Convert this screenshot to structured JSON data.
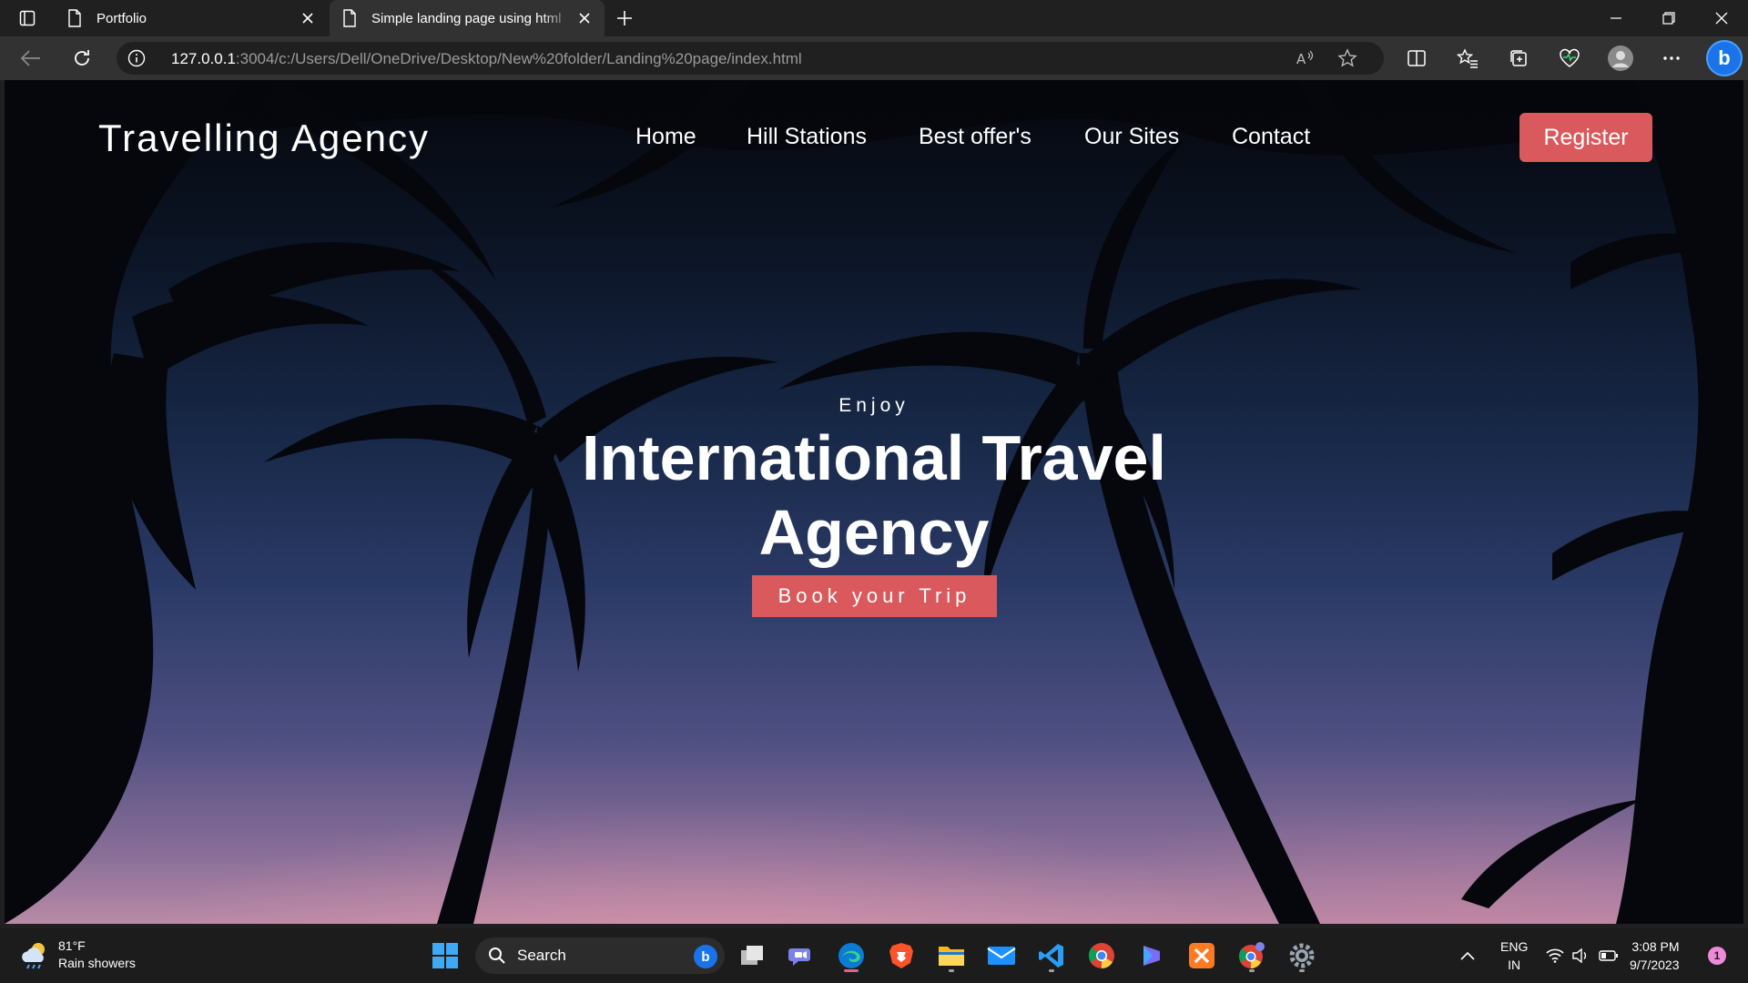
{
  "browser": {
    "tabs": [
      {
        "title": "Portfolio",
        "active": false
      },
      {
        "title": "Simple landing page using html",
        "active": true
      }
    ],
    "url_host": "127.0.0.1",
    "url_rest": ":3004/c:/Users/Dell/OneDrive/Desktop/New%20folder/Landing%20page/index.html"
  },
  "page": {
    "brand": "Travelling Agency",
    "nav": [
      "Home",
      "Hill Stations",
      "Best offer's",
      "Our Sites",
      "Contact"
    ],
    "register_label": "Register",
    "hero_sub": "Enjoy",
    "hero_title": "International Travel Agency",
    "cta_label": "Book your Trip",
    "accent": "#d9595c"
  },
  "taskbar": {
    "weather_temp": "81°F",
    "weather_desc": "Rain showers",
    "search_label": "Search",
    "lang_line1": "ENG",
    "lang_line2": "IN",
    "time": "3:08 PM",
    "date": "9/7/2023",
    "notification_count": "1",
    "apps": [
      "start-icon",
      "task-view-icon",
      "teams-icon",
      "edge-icon",
      "brave-icon",
      "file-explorer-icon",
      "mail-icon",
      "vscode-icon",
      "chrome-icon",
      "copilot-icon",
      "xampp-icon",
      "chrome-profile-icon",
      "settings-icon"
    ]
  }
}
